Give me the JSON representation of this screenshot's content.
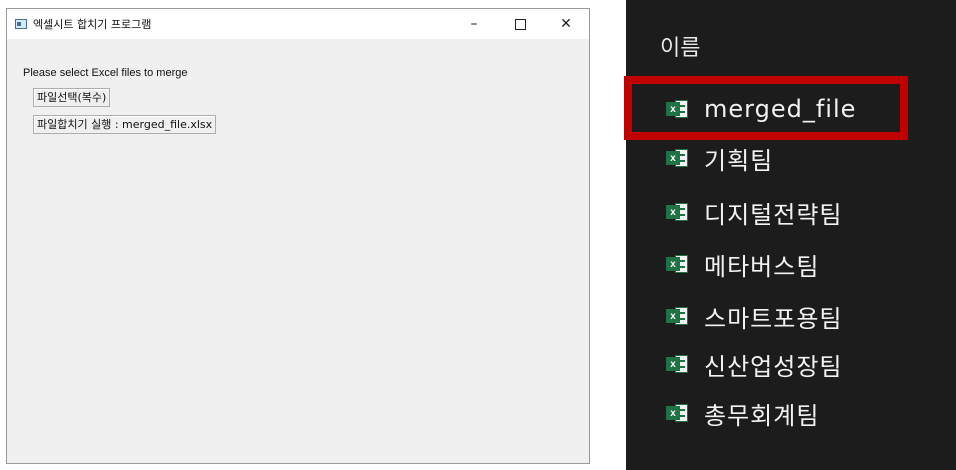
{
  "window": {
    "title": "엑셀시트 합치기 프로그램",
    "controls": {
      "minimize": "–",
      "maximize": "☐",
      "close": "✕"
    },
    "prompt": "Please select Excel files to merge",
    "buttons": {
      "select_files": "파일선택(복수)",
      "run_merge": "파일합치기 실행 : merged_file.xlsx"
    }
  },
  "explorer": {
    "column_header": "이름",
    "icon": "excel-file-icon",
    "files": [
      {
        "name": "merged_file",
        "highlighted": true
      },
      {
        "name": "기획팀"
      },
      {
        "name": "디지털전략팀"
      },
      {
        "name": "메타버스팀"
      },
      {
        "name": "스마트포용팀"
      },
      {
        "name": "신산업성장팀"
      },
      {
        "name": "총무회계팀"
      }
    ]
  },
  "colors": {
    "highlight": "#c00000",
    "excel_green": "#1f7244",
    "explorer_bg": "#1c1c1c",
    "window_bg": "#f0f0f0"
  }
}
